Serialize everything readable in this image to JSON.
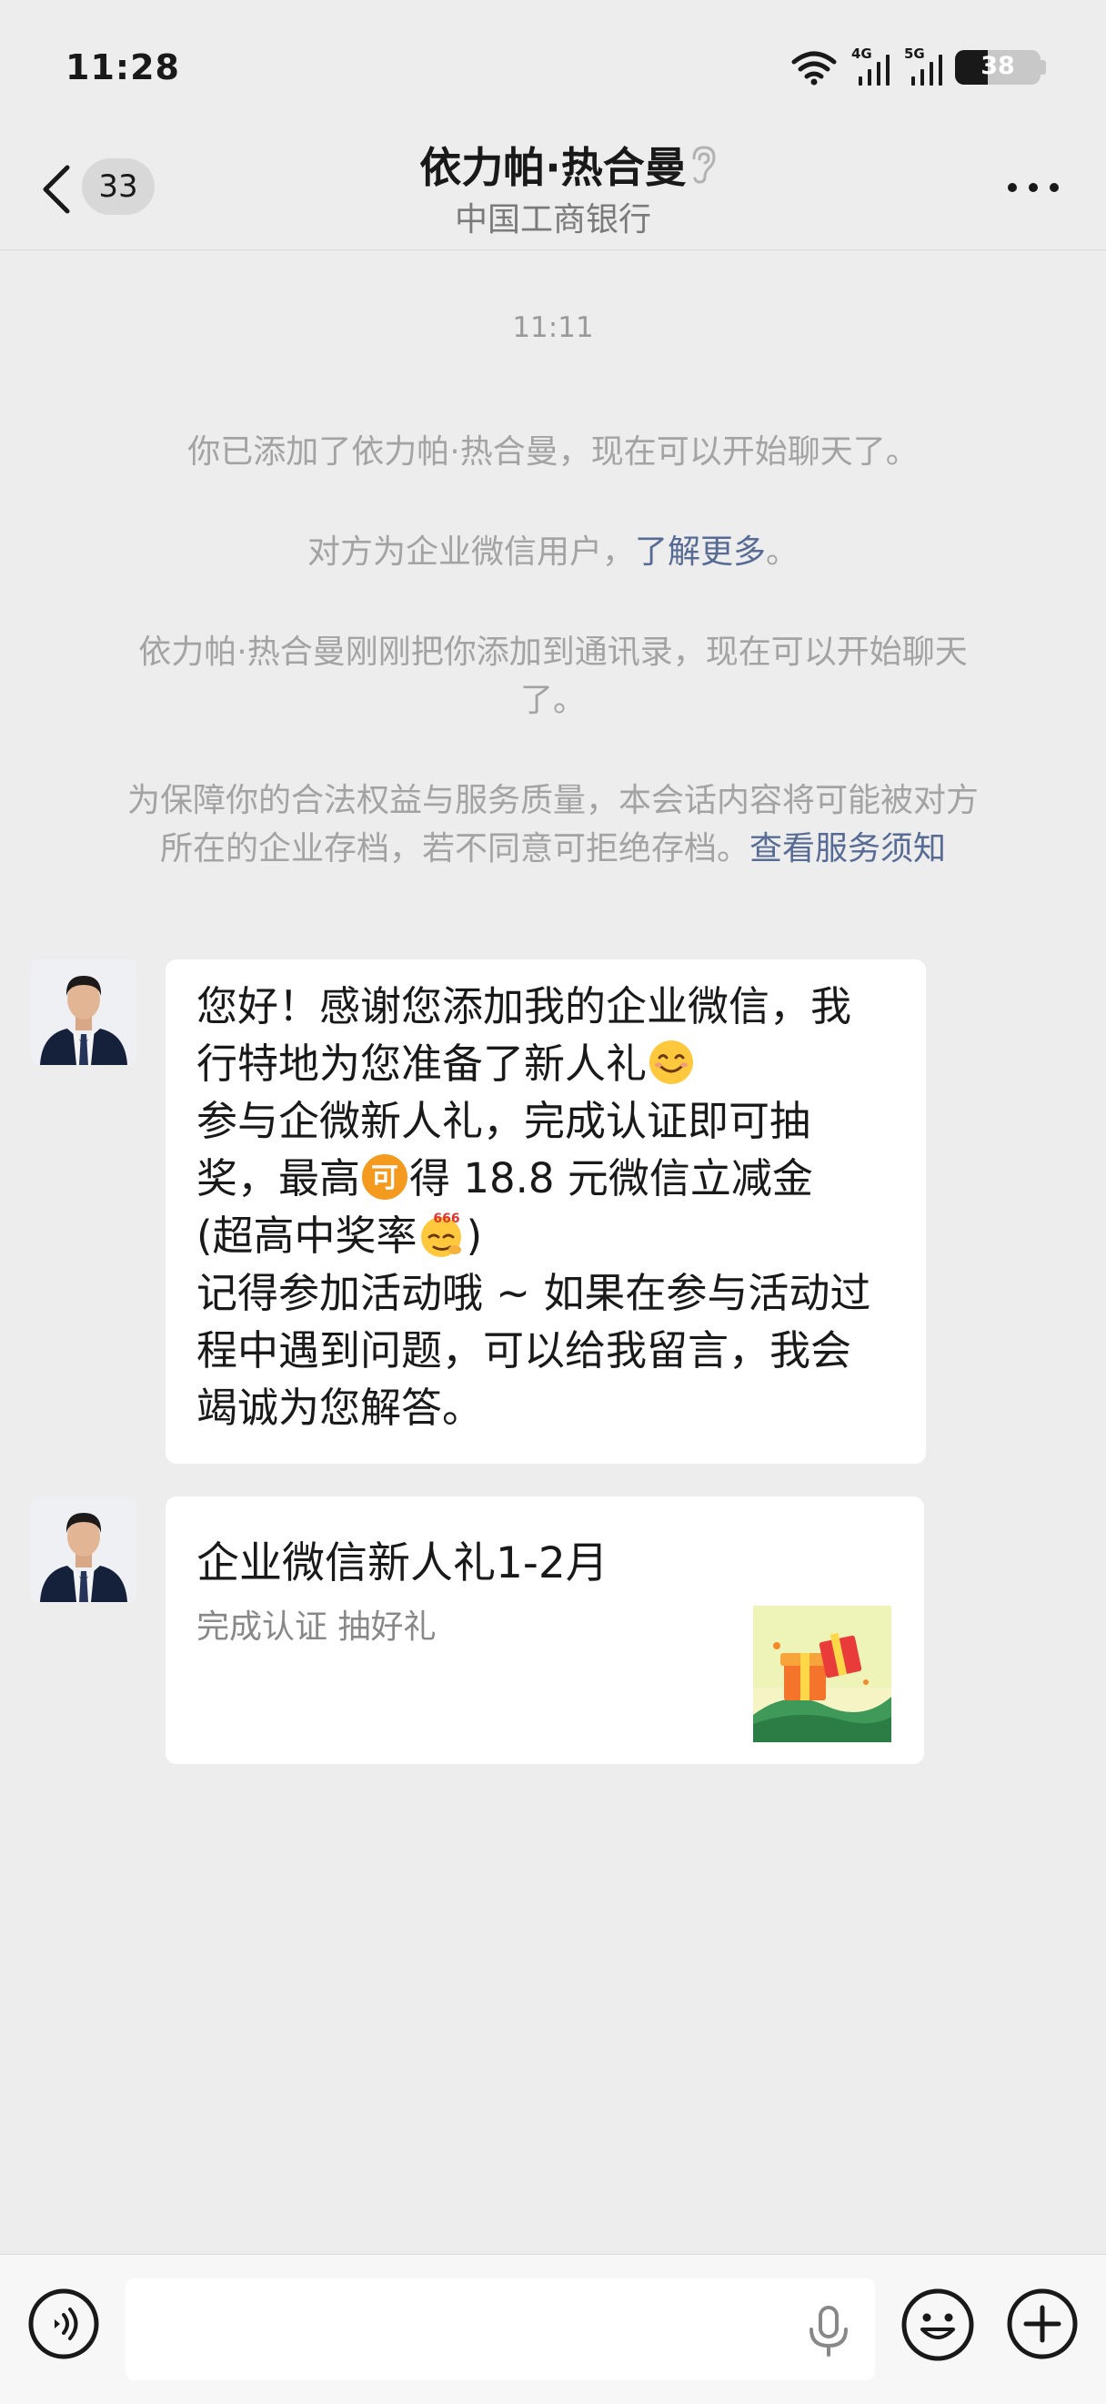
{
  "status_bar": {
    "time": "11:28",
    "signal_1": "4G",
    "signal_2": "5G",
    "battery": "38"
  },
  "header": {
    "back_count": "33",
    "title": "依力帕·热合曼",
    "subtitle": "中国工商银行"
  },
  "chat": {
    "timestamp": "11:11",
    "system_messages": {
      "added": "你已添加了依力帕·热合曼，现在可以开始聊天了。",
      "enterprise_prefix": "对方为企业微信用户，",
      "enterprise_link": "了解更多",
      "enterprise_suffix": "。",
      "contact_line1": "依力帕·热合曼刚刚把你添加到通讯录，现在可以开始聊天",
      "contact_line2": "了。",
      "archive_line1": "为保障你的合法权益与服务质量，本会话内容将可能被对方",
      "archive_line2": "所在的企业存档，若不同意可拒绝存档。",
      "archive_link": "查看服务须知"
    },
    "message_1": {
      "line1": "您好！感谢您添加我的企业微信，我",
      "line2": "行特地为您准备了新人礼",
      "line3": "参与企微新人礼，完成认证即可抽",
      "line4_a": "奖，最高",
      "line4_b": "得 18.8 元微信立减金",
      "line5_a": "(超高中奖率",
      "line5_b": ")",
      "line6": "记得参加活动哦 ~ 如果在参与活动过",
      "line7": "程中遇到问题，可以给我留言，我会",
      "line8": "竭诚为您解答。",
      "emoji_smile": "smile-emoji",
      "emoji_ke": "可",
      "emoji_666": "666"
    },
    "message_2": {
      "title": "企业微信新人礼1-2月",
      "description": "完成认证 抽好礼"
    }
  },
  "input_bar": {
    "placeholder": ""
  },
  "colors": {
    "background": "#ededed",
    "link": "#576b95",
    "system_text": "#a3a3a3",
    "bubble": "#ffffff"
  }
}
